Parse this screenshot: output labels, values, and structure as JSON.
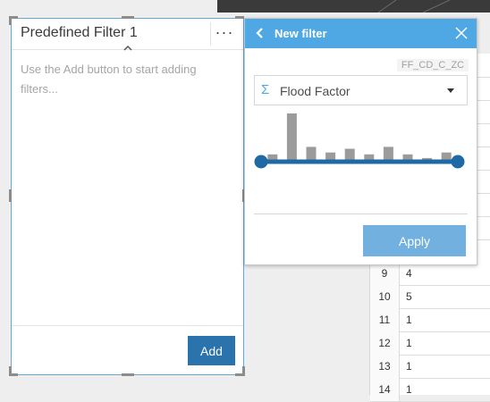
{
  "widget": {
    "title": "Predefined Filter 1",
    "more_label": "···",
    "placeholder": "Use the Add button to start adding filters...",
    "add_label": "Add"
  },
  "filter_panel": {
    "title": "New filter",
    "field_code": "FF_CD_C_ZC",
    "field_icon": "Σ",
    "field_name": "Flood Factor",
    "histogram_bins": [
      6,
      50,
      14,
      8,
      12,
      6,
      14,
      6,
      2,
      8
    ],
    "apply_label": "Apply"
  },
  "table": {
    "rows": [
      {
        "num": "9",
        "value": "4"
      },
      {
        "num": "10",
        "value": "5"
      },
      {
        "num": "11",
        "value": "1"
      },
      {
        "num": "12",
        "value": "1"
      },
      {
        "num": "13",
        "value": "1"
      },
      {
        "num": "14",
        "value": "1"
      }
    ]
  },
  "colors": {
    "accent": "#4fa8e3",
    "add_button": "#2b73ad",
    "apply_button": "#72b0e0",
    "slider": "#1f6aa5"
  }
}
